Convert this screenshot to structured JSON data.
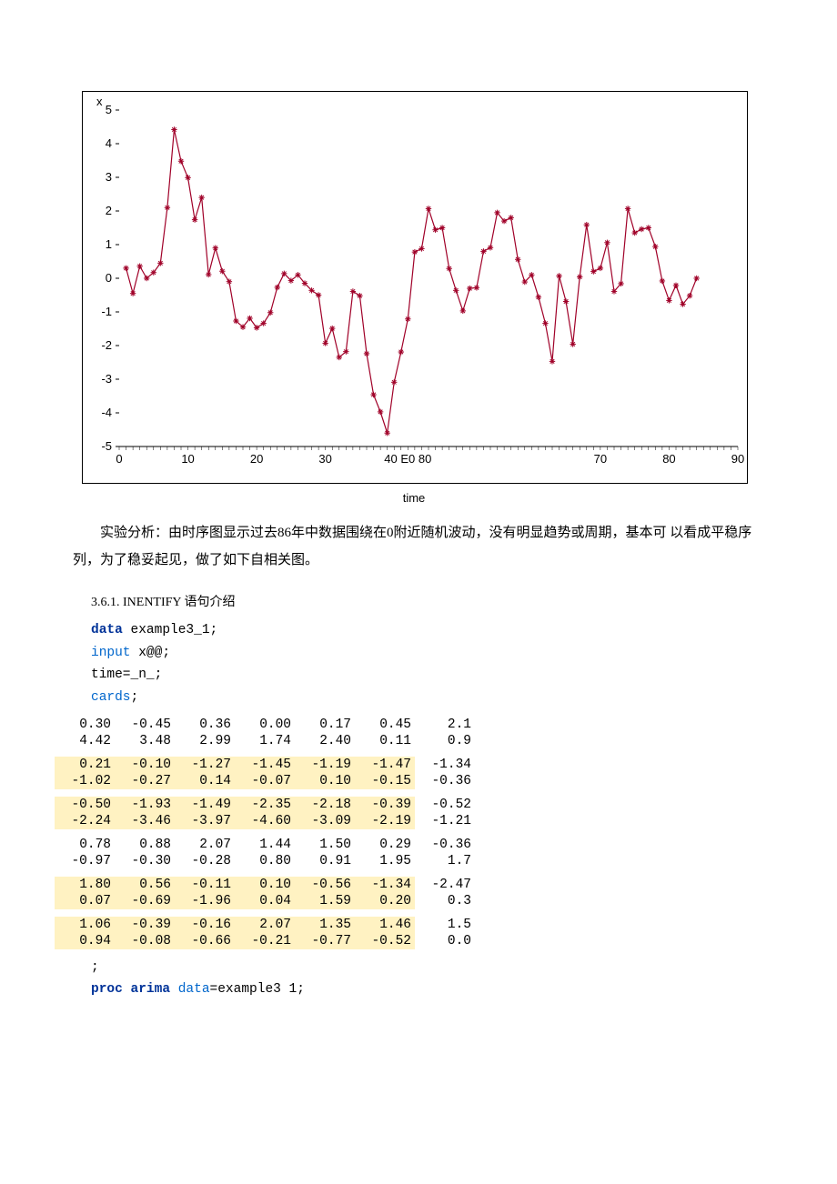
{
  "chart_data": {
    "type": "line",
    "ylabel": "x",
    "xlabel": "time",
    "xlim": [
      0,
      90
    ],
    "ylim": [
      -5,
      5
    ],
    "xticks": [
      0,
      10,
      20,
      30,
      "40 E0 80",
      70,
      80,
      90
    ],
    "xtick_pos": [
      0,
      10,
      20,
      30,
      42,
      70,
      80,
      90
    ],
    "yticks": [
      -5,
      -4,
      -3,
      -2,
      -1,
      0,
      1,
      2,
      3,
      4,
      5
    ],
    "values": [
      0.3,
      -0.45,
      0.36,
      0.0,
      0.17,
      0.45,
      2.1,
      4.42,
      3.48,
      2.99,
      1.74,
      2.4,
      0.11,
      0.9,
      0.21,
      -0.1,
      -1.27,
      -1.45,
      -1.19,
      -1.47,
      -1.34,
      -1.02,
      -0.27,
      0.14,
      -0.07,
      0.1,
      -0.15,
      -0.36,
      -0.5,
      -1.93,
      -1.49,
      -2.35,
      -2.18,
      -0.39,
      -0.52,
      -2.24,
      -3.46,
      -3.97,
      -4.6,
      -3.09,
      -2.19,
      -1.21,
      0.78,
      0.88,
      2.07,
      1.44,
      1.5,
      0.29,
      -0.36,
      -0.97,
      -0.3,
      -0.28,
      0.8,
      0.91,
      1.95,
      1.7,
      1.8,
      0.56,
      -0.11,
      0.1,
      -0.56,
      -1.34,
      -2.47,
      0.07,
      -0.69,
      -1.96,
      0.04,
      1.59,
      0.2,
      0.3,
      1.06,
      -0.39,
      -0.16,
      2.07,
      1.35,
      1.46,
      1.5,
      0.94,
      -0.08,
      -0.66,
      -0.21,
      -0.77,
      -0.52,
      0.0
    ]
  },
  "para1": "实验分析：由时序图显示过去86年中数据围绕在0附近随机波动，没有明显趋势或周期，基本可  以看成平稳序列，为了稳妥起见，做了如下自相关图。",
  "section": "3.6.1.   INENTIFY 语句介绍",
  "code": {
    "l1_kw": "data",
    "l1_rest": " example3_1;",
    "l2_opt": "input",
    "l2_rest": " x@@;",
    "l3": "time=_n_;",
    "l4_opt": "cards",
    "l4_rest": ";"
  },
  "table": [
    [
      "0.30",
      "-0.45",
      "0.36",
      "0.00",
      "0.17",
      "0.45",
      "2.1"
    ],
    [
      "4.42",
      "3.48",
      "2.99",
      "1.74",
      "2.40",
      "0.11",
      "0.9"
    ],
    [
      "0.21",
      "-0.10",
      "-1.27",
      "-1.45",
      "-1.19",
      "-1.47",
      "-1.34"
    ],
    [
      "-1.02",
      "-0.27",
      "0.14",
      "-0.07",
      "0.10",
      "-0.15",
      "-0.36"
    ],
    [
      "-0.50",
      "-1.93",
      "-1.49",
      "-2.35",
      "-2.18",
      "-0.39",
      "-0.52"
    ],
    [
      "-2.24",
      "-3.46",
      "-3.97",
      "-4.60",
      "-3.09",
      "-2.19",
      "-1.21"
    ],
    [
      "0.78",
      "0.88",
      "2.07",
      "1.44",
      "1.50",
      "0.29",
      "-0.36"
    ],
    [
      "-0.97",
      "-0.30",
      "-0.28",
      "0.80",
      "0.91",
      "1.95",
      "1.7"
    ],
    [
      "1.80",
      "0.56",
      "-0.11",
      "0.10",
      "-0.56",
      "-1.34",
      "-2.47"
    ],
    [
      "0.07",
      "-0.69",
      "-1.96",
      "0.04",
      "1.59",
      "0.20",
      "0.3"
    ],
    [
      "1.06",
      "-0.39",
      "-0.16",
      "2.07",
      "1.35",
      "1.46",
      "1.5"
    ],
    [
      "0.94",
      "-0.08",
      "-0.66",
      "-0.21",
      "-0.77",
      "-0.52",
      "0.0"
    ]
  ],
  "code2": {
    "semi": ";",
    "l1_kw": "proc arima ",
    "l1_opt": "data",
    "l1_rest": "=example3 1;"
  }
}
